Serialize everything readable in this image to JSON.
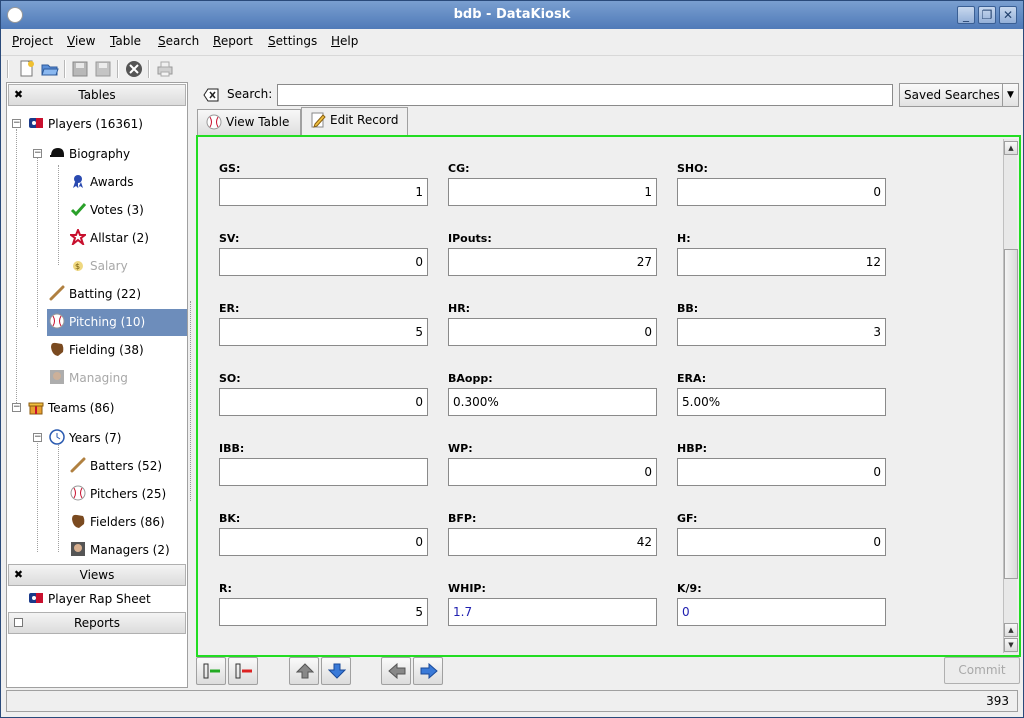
{
  "window": {
    "title": "bdb - DataKiosk"
  },
  "menu": [
    "Project",
    "View",
    "Table",
    "Search",
    "Report",
    "Settings",
    "Help"
  ],
  "sidebar": {
    "tables_header": "Tables",
    "views_header": "Views",
    "reports_header": "Reports",
    "tree": {
      "players": "Players (16361)",
      "biography": "Biography",
      "awards": "Awards",
      "votes": "Votes (3)",
      "allstar": "Allstar (2)",
      "salary": "Salary",
      "batting": "Batting (22)",
      "pitching": "Pitching (10)",
      "fielding": "Fielding (38)",
      "managing": "Managing",
      "teams": "Teams (86)",
      "years": "Years (7)",
      "batters": "Batters (52)",
      "pitchers": "Pitchers (25)",
      "fielders": "Fielders (86)",
      "managers": "Managers (2)"
    },
    "views": {
      "player_rap_sheet": "Player Rap Sheet"
    }
  },
  "search": {
    "label": "Search:",
    "value": "",
    "saved_searches": "Saved Searches"
  },
  "tabs": {
    "view_table": "View Table",
    "edit_record": "Edit Record"
  },
  "form": {
    "fields": [
      {
        "label": "GS:",
        "value": "1"
      },
      {
        "label": "CG:",
        "value": "1"
      },
      {
        "label": "SHO:",
        "value": "0"
      },
      {
        "label": "SV:",
        "value": "0"
      },
      {
        "label": "IPouts:",
        "value": "27"
      },
      {
        "label": "H:",
        "value": "12"
      },
      {
        "label": "ER:",
        "value": "5"
      },
      {
        "label": "HR:",
        "value": "0"
      },
      {
        "label": "BB:",
        "value": "3"
      },
      {
        "label": "SO:",
        "value": "0"
      },
      {
        "label": "BAopp:",
        "value": "0.300%"
      },
      {
        "label": "ERA:",
        "value": "5.00%"
      },
      {
        "label": "IBB:",
        "value": ""
      },
      {
        "label": "WP:",
        "value": "0"
      },
      {
        "label": "HBP:",
        "value": "0"
      },
      {
        "label": "BK:",
        "value": "0"
      },
      {
        "label": "BFP:",
        "value": "42"
      },
      {
        "label": "GF:",
        "value": "0"
      },
      {
        "label": "R:",
        "value": "5"
      },
      {
        "label": "WHIP:",
        "value": "1.7"
      },
      {
        "label": "K/9:",
        "value": "0"
      }
    ]
  },
  "nav": {
    "commit": "Commit"
  },
  "status": {
    "record_id": "393"
  },
  "colors": {
    "selection": "#6d8dbb",
    "focus_border": "#22dd22",
    "title_bar": "#4f7ab8"
  }
}
